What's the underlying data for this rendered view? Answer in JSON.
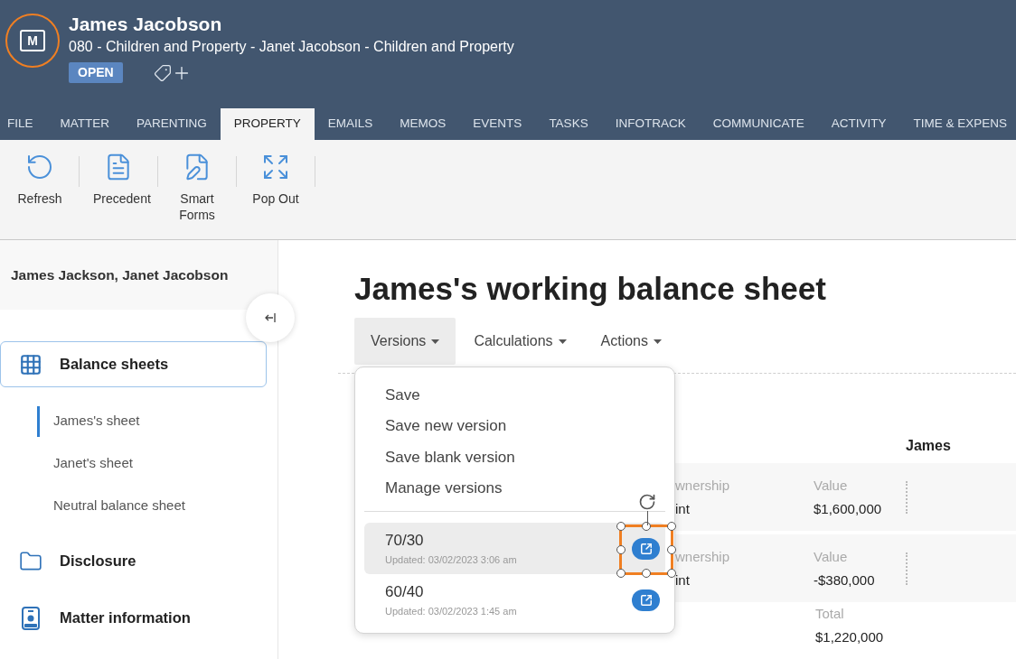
{
  "header": {
    "logo_letter": "M",
    "title": "James Jacobson",
    "subtitle": "080 - Children and Property - Janet Jacobson - Children and Property",
    "status": "OPEN"
  },
  "tabs": [
    {
      "label": "FILE",
      "selected": false
    },
    {
      "label": "MATTER",
      "selected": false
    },
    {
      "label": "PARENTING",
      "selected": false
    },
    {
      "label": "PROPERTY",
      "selected": true
    },
    {
      "label": "EMAILS",
      "selected": false
    },
    {
      "label": "MEMOS",
      "selected": false
    },
    {
      "label": "EVENTS",
      "selected": false
    },
    {
      "label": "TASKS",
      "selected": false
    },
    {
      "label": "INFOTRACK",
      "selected": false
    },
    {
      "label": "COMMUNICATE",
      "selected": false
    },
    {
      "label": "ACTIVITY",
      "selected": false
    },
    {
      "label": "TIME & EXPENS",
      "selected": false
    }
  ],
  "ribbon": [
    {
      "kind": "refresh",
      "label": "Refresh"
    },
    {
      "kind": "precedent",
      "label": "Precedent"
    },
    {
      "kind": "forms",
      "label": "Smart Forms"
    },
    {
      "kind": "popout",
      "label": "Pop Out"
    }
  ],
  "sidebar": {
    "header": "James Jackson, Janet Jacobson",
    "items": [
      {
        "kind": "grid",
        "label": "Balance sheets",
        "selected": true,
        "children": [
          {
            "label": "James's sheet",
            "selected": true
          },
          {
            "label": "Janet's sheet",
            "selected": false
          },
          {
            "label": "Neutral balance sheet",
            "selected": false
          }
        ]
      },
      {
        "kind": "folder",
        "label": "Disclosure",
        "selected": false
      },
      {
        "kind": "badge",
        "label": "Matter information",
        "selected": false
      }
    ]
  },
  "main": {
    "title": "James's working balance sheet",
    "menus": [
      {
        "label": "Versions",
        "expanded": true
      },
      {
        "label": "Calculations",
        "expanded": false
      },
      {
        "label": "Actions",
        "expanded": false
      }
    ],
    "dropdown": {
      "actions": [
        "Save",
        "Save new version",
        "Save blank version",
        "Manage versions"
      ],
      "versions": [
        {
          "name": "70/30",
          "updated": "Updated: 03/02/2023 3:06 am",
          "selected": true,
          "framed": true
        },
        {
          "name": "60/40",
          "updated": "Updated: 03/02/2023 1:45 am",
          "selected": false,
          "framed": false
        }
      ]
    },
    "table": {
      "column": "James",
      "rows": [
        {
          "col1_label": "wnership",
          "col1_value": "int",
          "value_label": "Value",
          "value": "$1,600,000"
        },
        {
          "col1_label": "wnership",
          "col1_value": "int",
          "value_label": "Value",
          "value": "-$380,000"
        }
      ],
      "total": {
        "label": "Total",
        "value": "$1,220,000"
      }
    }
  }
}
